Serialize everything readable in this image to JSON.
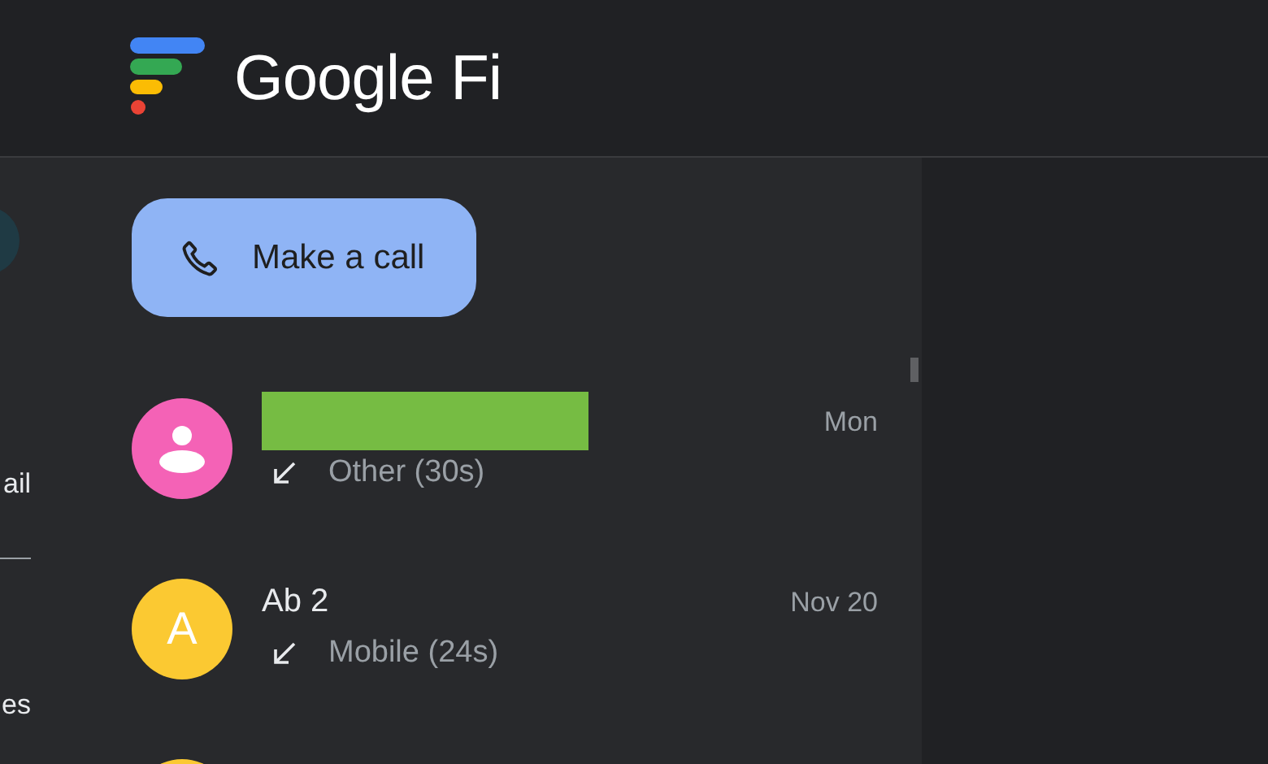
{
  "header": {
    "product_name": "Google Fi"
  },
  "sidebar": {
    "items": [
      {
        "label": "ail"
      },
      {
        "label": "es"
      }
    ]
  },
  "action_button": {
    "label": "Make a call"
  },
  "calls": [
    {
      "avatar": {
        "kind": "person",
        "color": "#f462b6"
      },
      "name_redacted": true,
      "incoming": true,
      "detail": "Other (30s)",
      "date": "Mon"
    },
    {
      "avatar": {
        "kind": "letter",
        "letter": "A",
        "color": "#fbc932"
      },
      "name": "Ab 2",
      "name_redacted": false,
      "incoming": true,
      "detail": "Mobile (24s)",
      "date": "Nov 20"
    },
    {
      "avatar": {
        "kind": "blank",
        "color": "#fbc932"
      }
    }
  ]
}
